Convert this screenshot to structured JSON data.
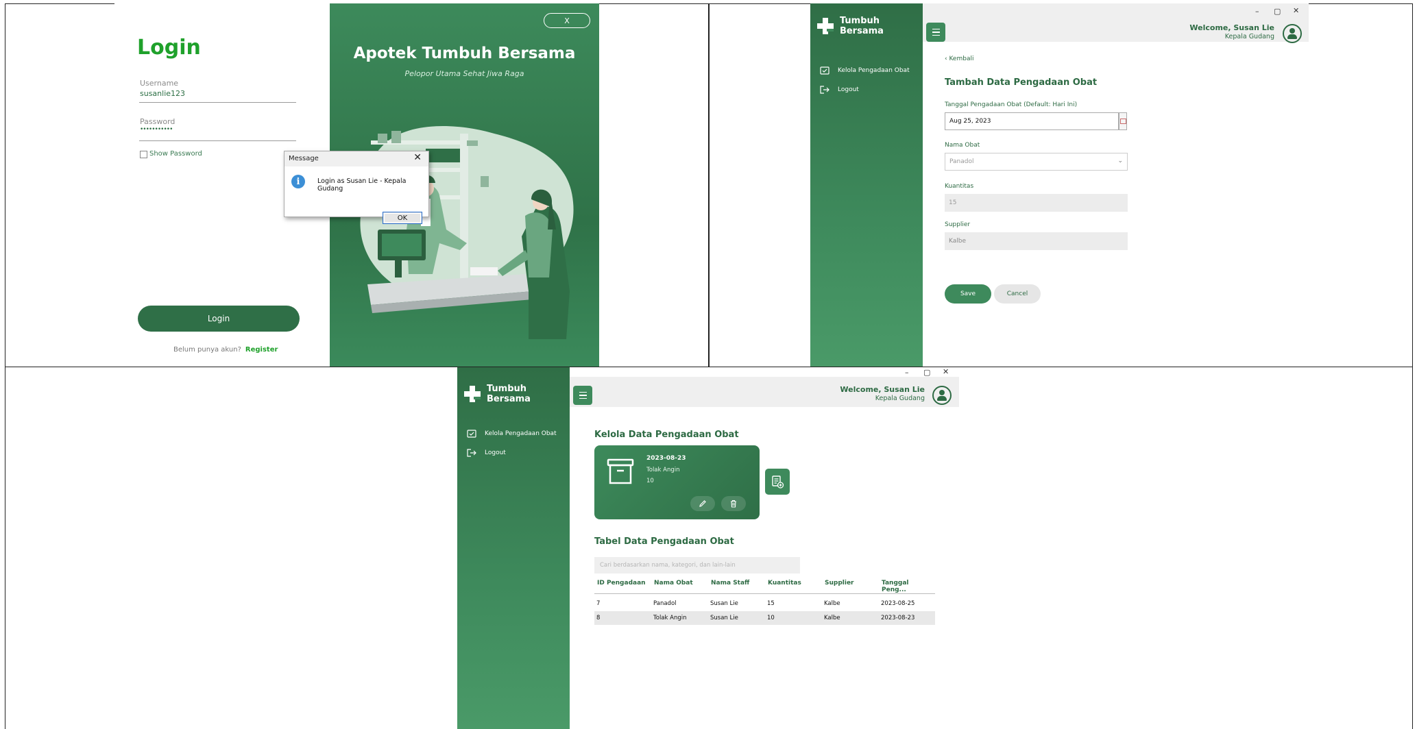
{
  "login_panel": {
    "title": "Login",
    "username_label": "Username",
    "username_value": "susanlie123",
    "password_label": "Password",
    "password_value": "•••••••••••",
    "show_password_label": "Show Password",
    "login_button": "Login",
    "register_prompt": "Belum punya akun?",
    "register_link": "Register",
    "brand_title": "Apotek Tumbuh Bersama",
    "brand_tagline": "Pelopor Utama Sehat Jiwa Raga",
    "close_button": "X",
    "dialog": {
      "title": "Message",
      "message": "Login as Susan Lie - Kepala Gudang",
      "ok": "OK",
      "icon": "info-icon"
    }
  },
  "app": {
    "brand": "Tumbuh Bersama",
    "nav": [
      {
        "label": "Kelola Pengadaan Obat",
        "icon": "clipboard-check-icon"
      },
      {
        "label": "Logout",
        "icon": "logout-icon"
      }
    ],
    "welcome": "Welcome, Susan Lie",
    "role": "Kepala Gudang",
    "window_controls": {
      "minimize": "–",
      "maximize": "▢",
      "close": "✕"
    }
  },
  "form_panel": {
    "back": "Kembali",
    "title": "Tambah Data Pengadaan Obat",
    "date_label": "Tanggal Pengadaan Obat (Default: Hari Ini)",
    "date_value": "Aug 25, 2023",
    "drug_label": "Nama Obat",
    "drug_value": "Panadol",
    "qty_label": "Kuantitas",
    "qty_value": "15",
    "supplier_label": "Supplier",
    "supplier_value": "Kalbe",
    "save": "Save",
    "cancel": "Cancel"
  },
  "list_panel": {
    "section_title": "Kelola Data Pengadaan Obat",
    "card": {
      "date": "2023-08-23",
      "name": "Tolak Angin",
      "qty": "10"
    },
    "table_title": "Tabel Data Pengadaan Obat",
    "search_placeholder": "Cari berdasarkan nama, kategori, dan lain-lain",
    "columns": [
      "ID Pengadaan",
      "Nama Obat",
      "Nama Staff",
      "Kuantitas",
      "Supplier",
      "Tanggal Peng..."
    ],
    "rows": [
      [
        "7",
        "Panadol",
        "Susan Lie",
        "15",
        "Kalbe",
        "2023-08-25"
      ],
      [
        "8",
        "Tolak Angin",
        "Susan Lie",
        "10",
        "Kalbe",
        "2023-08-23"
      ]
    ]
  }
}
